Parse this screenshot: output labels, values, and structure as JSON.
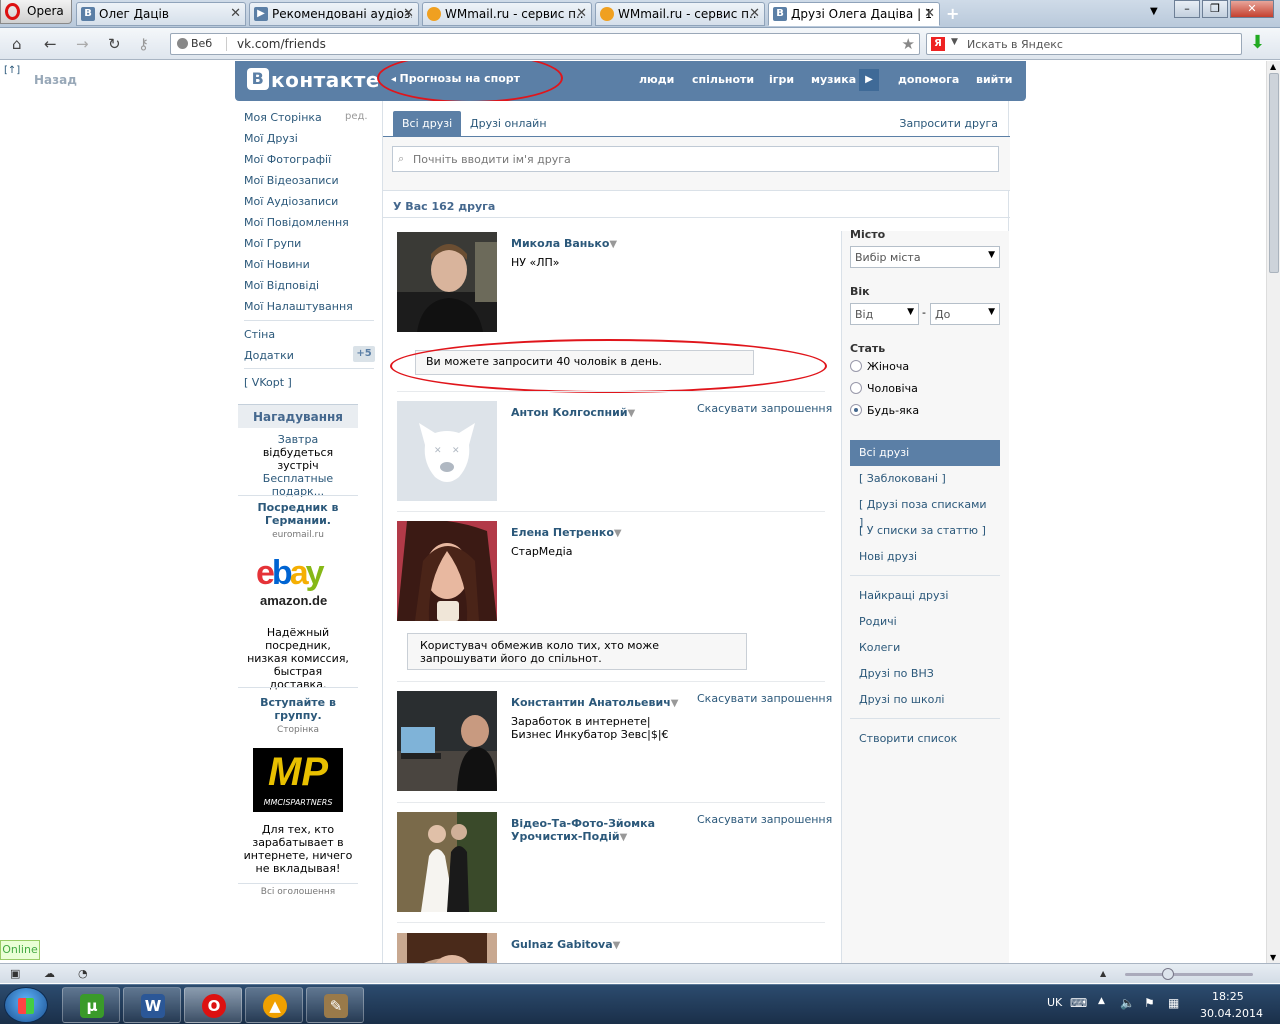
{
  "browser": {
    "menu_label": "Opera",
    "tabs": [
      {
        "label": "Олег Даців",
        "favicon": "vk-icon"
      },
      {
        "label": "Рекомендовані аудіоз...",
        "favicon": "vk-icon"
      },
      {
        "label": "WMmail.ru - сервис п...",
        "favicon": "wmmail-icon"
      },
      {
        "label": "WMmail.ru - сервис п...",
        "favicon": "wmmail-icon"
      },
      {
        "label": "Друзі Олега Даціва | 1...",
        "favicon": "vk-icon"
      }
    ],
    "address_prefix": "Веб",
    "url": "vk.com/friends",
    "search_placeholder": "Искать в Яндекс"
  },
  "page": {
    "back_label": "Назад",
    "header": {
      "logo": "контакте",
      "logo_letter": "В",
      "promo": "Прогнозы на спорт",
      "nav": [
        "люди",
        "спільноти",
        "ігри",
        "музика",
        "допомога",
        "вийти"
      ]
    },
    "left_menu": {
      "items": [
        "Моя Сторінка",
        "Мої Друзі",
        "Мої Фотографії",
        "Мої Відеозаписи",
        "Мої Аудіозаписи",
        "Мої Повідомлення",
        "Мої Групи",
        "Мої Новини",
        "Мої Відповіді",
        "Мої Налаштування"
      ],
      "edit": "ред.",
      "wall": "Стіна",
      "apps": "Додатки",
      "apps_badge": "+5",
      "vkopt": "[ VKopt ]"
    },
    "reminder": {
      "title": "Нагадування",
      "prefix": "Завтра",
      "middle": " відбудеться зустріч ",
      "link": "Бесплатные подарк..."
    },
    "ads": [
      {
        "title": "Посредник в Германии.",
        "domain": "euromail.ru",
        "logo_top": "ebay",
        "logo_bottom": "amazon.de",
        "text": "Надёжный посредник, низкая комиссия, быстрая доставка."
      },
      {
        "title": "Вступайте в группу.",
        "domain": "Сторінка",
        "logo_top": "MP",
        "logo_bottom": "MMCISPARTNERS",
        "text": "Для тех, кто зарабатывает в интернете, ничего не вкладывая!"
      }
    ],
    "all_ads": "Всі оголошення",
    "friends": {
      "tabs": [
        "Всі друзі",
        "Друзі онлайн"
      ],
      "invite": "Запросити друга",
      "search_placeholder": "Почніть вводити ім'я друга",
      "count_label": "У Вас 162 друга",
      "cancel_label": "Скасувати запрошення",
      "list": [
        {
          "name": "Микола Ванько",
          "sub": "НУ «ЛП»",
          "tip": "Ви можете запросити 40 чоловік в день."
        },
        {
          "name": "Антон Колгоспний",
          "sub": "",
          "cancel": true
        },
        {
          "name": "Елена Петренко",
          "sub": "СтарМедіа",
          "tip": "Користувач обмежив коло тих, хто може запрошувати його до спільнот."
        },
        {
          "name": "Константин Анатольевич",
          "sub": "Заработок в интернете|Бизнес Инкубатор Зевс|$|€",
          "cancel": true
        },
        {
          "name": "Відео-Та-Фото-Зйомка Урочистих-Подій",
          "sub": "",
          "cancel": true
        },
        {
          "name": "Gulnaz Gabitova",
          "sub": ""
        }
      ]
    },
    "filters": {
      "city_label": "Місто",
      "city_select": "Вибір міста",
      "age_label": "Вік",
      "age_from": "Від",
      "age_to": "До",
      "age_dash": "-",
      "sex_label": "Стать",
      "sex_options": [
        "Жіноча",
        "Чоловіча",
        "Будь-яка"
      ],
      "sex_selected": "Будь-яка",
      "lists_a": [
        "Всі друзі",
        "[ Заблоковані ]",
        "[ Друзі поза списками ]",
        "[ У списки за статтю ]",
        "Нові друзі"
      ],
      "lists_b": [
        "Найкращі друзі",
        "Родичі",
        "Колеги",
        "Друзі по ВНЗ",
        "Друзі по школі"
      ],
      "create_list": "Створити список"
    }
  },
  "status": {
    "online": "Online"
  },
  "taskbar": {
    "apps": [
      "utorrent-icon",
      "word-icon",
      "opera-icon",
      "aimp-icon",
      "paint-icon"
    ],
    "lang": "UK",
    "time": "18:25",
    "date": "30.04.2014"
  },
  "colors": {
    "vk_blue": "#5b7fa6",
    "link": "#2b587a",
    "annotation_red": "#e0151b"
  }
}
